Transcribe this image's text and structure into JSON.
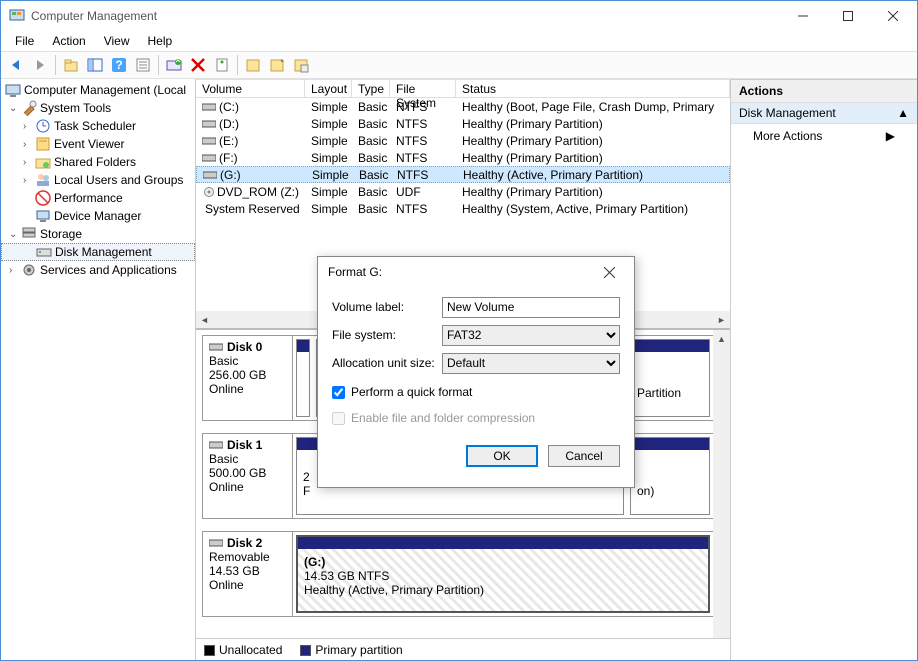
{
  "window": {
    "title": "Computer Management"
  },
  "menu": {
    "file": "File",
    "action": "Action",
    "view": "View",
    "help": "Help"
  },
  "tree": {
    "root": "Computer Management (Local",
    "system_tools": "System Tools",
    "task_scheduler": "Task Scheduler",
    "event_viewer": "Event Viewer",
    "shared_folders": "Shared Folders",
    "local_users": "Local Users and Groups",
    "performance": "Performance",
    "device_manager": "Device Manager",
    "storage": "Storage",
    "disk_management": "Disk Management",
    "services": "Services and Applications"
  },
  "vol_headers": {
    "volume": "Volume",
    "layout": "Layout",
    "type": "Type",
    "fs": "File System",
    "status": "Status"
  },
  "volumes": [
    {
      "name": "(C:)",
      "layout": "Simple",
      "type": "Basic",
      "fs": "NTFS",
      "status": "Healthy (Boot, Page File, Crash Dump, Primary"
    },
    {
      "name": "(D:)",
      "layout": "Simple",
      "type": "Basic",
      "fs": "NTFS",
      "status": "Healthy (Primary Partition)"
    },
    {
      "name": "(E:)",
      "layout": "Simple",
      "type": "Basic",
      "fs": "NTFS",
      "status": "Healthy (Primary Partition)"
    },
    {
      "name": "(F:)",
      "layout": "Simple",
      "type": "Basic",
      "fs": "NTFS",
      "status": "Healthy (Primary Partition)"
    },
    {
      "name": "(G:)",
      "layout": "Simple",
      "type": "Basic",
      "fs": "NTFS",
      "status": "Healthy (Active, Primary Partition)"
    },
    {
      "name": "DVD_ROM (Z:)",
      "layout": "Simple",
      "type": "Basic",
      "fs": "UDF",
      "status": "Healthy (Primary Partition)"
    },
    {
      "name": "System Reserved",
      "layout": "Simple",
      "type": "Basic",
      "fs": "NTFS",
      "status": "Healthy (System, Active, Primary Partition)"
    }
  ],
  "disks": [
    {
      "name": "Disk 0",
      "type": "Basic",
      "size": "256.00 GB",
      "state": "Online"
    },
    {
      "name": "Disk 1",
      "type": "Basic",
      "size": "500.00 GB",
      "state": "Online"
    },
    {
      "name": "Disk 2",
      "type": "Removable",
      "size": "14.53 GB",
      "state": "Online"
    }
  ],
  "disk2_part": {
    "label": "(G:)",
    "line2": "14.53 GB NTFS",
    "line3": "Healthy (Active, Primary Partition)"
  },
  "legend": {
    "unallocated": "Unallocated",
    "primary": "Primary partition"
  },
  "actions": {
    "header": "Actions",
    "section": "Disk Management",
    "more": "More Actions"
  },
  "dialog": {
    "title": "Format G:",
    "volume_label_lbl": "Volume label:",
    "volume_label_val": "New Volume",
    "fs_lbl": "File system:",
    "fs_val": "FAT32",
    "au_lbl": "Allocation unit size:",
    "au_val": "Default",
    "quick": "Perform a quick format",
    "compress": "Enable file and folder compression",
    "ok": "OK",
    "cancel": "Cancel"
  },
  "disk1_partition_trail": "on)",
  "disk0_partition_trail": "Partition"
}
